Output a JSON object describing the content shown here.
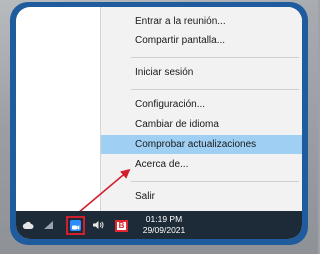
{
  "menu": {
    "items": [
      {
        "label": "Entrar a la reunión..."
      },
      {
        "label": "Compartir pantalla..."
      },
      {
        "label": "Iniciar sesión"
      },
      {
        "label": "Configuración..."
      },
      {
        "label": "Cambiar de idioma"
      },
      {
        "label": "Comprobar actualizaciones",
        "highlighted": true
      },
      {
        "label": "Acerca de..."
      },
      {
        "label": "Salir"
      }
    ]
  },
  "taskbar": {
    "time": "01:19 PM",
    "date": "29/09/2021",
    "b_label": "B",
    "icons": [
      "cloud-icon",
      "network-icon",
      "zoom-app-icon",
      "volume-icon",
      "b-app-icon"
    ]
  },
  "colors": {
    "frame": "#1f5c9e",
    "highlight_row": "#9fd0f3",
    "taskbar": "#1d2a38",
    "annotation_red": "#d11f2b"
  }
}
